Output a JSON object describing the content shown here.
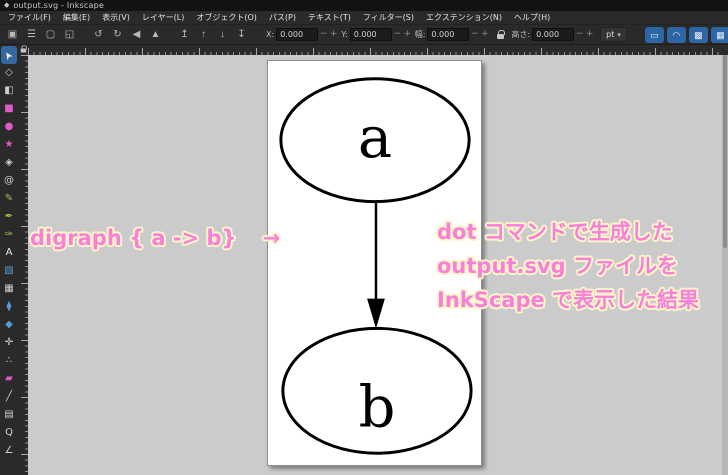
{
  "window": {
    "title": "output.svg - Inkscape",
    "icon_glyph": "◆"
  },
  "menubar": {
    "items": [
      "ファイル(F)",
      "編集(E)",
      "表示(V)",
      "レイヤー(L)",
      "オブジェクト(O)",
      "パス(P)",
      "テキスト(T)",
      "フィルター(S)",
      "エクステンション(N)",
      "ヘルプ(H)"
    ]
  },
  "toolbar": {
    "select_buttons": [
      {
        "name": "select-all-button",
        "glyph": "▣"
      },
      {
        "name": "select-all-layers-button",
        "glyph": "☰"
      },
      {
        "name": "deselect-button",
        "glyph": "▢"
      },
      {
        "name": "selection-box-button",
        "glyph": "◱"
      }
    ],
    "transform_buttons": [
      {
        "name": "rotate-ccw-button",
        "glyph": "↺"
      },
      {
        "name": "rotate-cw-button",
        "glyph": "↻"
      },
      {
        "name": "flip-horizontal-button",
        "glyph": "◀"
      },
      {
        "name": "flip-vertical-button",
        "glyph": "▲"
      }
    ],
    "order_buttons": [
      {
        "name": "raise-to-top-button",
        "glyph": "↥"
      },
      {
        "name": "raise-button",
        "glyph": "↑"
      },
      {
        "name": "lower-button",
        "glyph": "↓"
      },
      {
        "name": "lower-to-bottom-button",
        "glyph": "↧"
      }
    ],
    "fields": [
      {
        "name": "x-field",
        "label": "X:",
        "value": "0.000"
      },
      {
        "name": "y-field",
        "label": "Y:",
        "value": "0.000"
      },
      {
        "name": "width-field",
        "label": "幅:",
        "value": "0.000"
      },
      {
        "name": "height-field",
        "label": "高さ:",
        "value": "0.000"
      }
    ],
    "spinner": {
      "minus": "−",
      "plus": "+"
    },
    "unit": {
      "value": "pt",
      "caret": "▾"
    },
    "affect_toggles": [
      {
        "name": "scale-stroke-toggle",
        "glyph": "▭"
      },
      {
        "name": "scale-corners-toggle",
        "glyph": "◠"
      },
      {
        "name": "move-gradients-toggle",
        "glyph": "▩"
      },
      {
        "name": "move-patterns-toggle",
        "glyph": "▦"
      }
    ],
    "accent_color": "#2c66a4"
  },
  "toolbox": {
    "selected_color": "#36679e",
    "tools": [
      {
        "name": "tool-selector",
        "glyph": "➤",
        "color": "#f2f2f2",
        "selected": true
      },
      {
        "name": "tool-node-editor",
        "glyph": "◇",
        "color": "#cfcfcf",
        "selected": false
      },
      {
        "name": "tool-shape-builder",
        "glyph": "◧",
        "color": "#cfcfcf",
        "selected": false
      },
      {
        "name": "tool-rectangle",
        "glyph": "■",
        "color": "#df5bc8",
        "selected": false
      },
      {
        "name": "tool-ellipse",
        "glyph": "●",
        "color": "#df5bc8",
        "selected": false
      },
      {
        "name": "tool-star",
        "glyph": "★",
        "color": "#df5bc8",
        "selected": false
      },
      {
        "name": "tool-3d-box",
        "glyph": "◈",
        "color": "#cfcfcf",
        "selected": false
      },
      {
        "name": "tool-spiral",
        "glyph": "@",
        "color": "#cfcfcf",
        "selected": false
      },
      {
        "name": "tool-pencil",
        "glyph": "✎",
        "color": "#9bc24f",
        "selected": false
      },
      {
        "name": "tool-bezier-pen",
        "glyph": "✒",
        "color": "#9bc24f",
        "selected": false
      },
      {
        "name": "tool-calligraphy",
        "glyph": "✑",
        "color": "#9bc24f",
        "selected": false
      },
      {
        "name": "tool-text",
        "glyph": "A",
        "color": "#e8e8e8",
        "selected": false
      },
      {
        "name": "tool-gradient",
        "glyph": "▧",
        "color": "#5b9bd5",
        "selected": false
      },
      {
        "name": "tool-mesh-gradient",
        "glyph": "▦",
        "color": "#cfcfcf",
        "selected": false
      },
      {
        "name": "tool-dropper",
        "glyph": "⧫",
        "color": "#5b9bd5",
        "selected": false
      },
      {
        "name": "tool-paint-bucket",
        "glyph": "◆",
        "color": "#5b9bd5",
        "selected": false
      },
      {
        "name": "tool-tweak",
        "glyph": "✛",
        "color": "#cfcfcf",
        "selected": false
      },
      {
        "name": "tool-spray",
        "glyph": "∴",
        "color": "#cfcfcf",
        "selected": false
      },
      {
        "name": "tool-eraser",
        "glyph": "▰",
        "color": "#df5bc8",
        "selected": false
      },
      {
        "name": "tool-connector",
        "glyph": "╱",
        "color": "#cfcfcf",
        "selected": false
      },
      {
        "name": "tool-pages",
        "glyph": "▤",
        "color": "#cfcfcf",
        "selected": false
      },
      {
        "name": "tool-zoom",
        "glyph": "Q",
        "color": "#cfcfcf",
        "selected": false
      },
      {
        "name": "tool-measure",
        "glyph": "∠",
        "color": "#cfcfcf",
        "selected": false
      }
    ]
  },
  "canvas": {
    "background_color": "#cbcbcb",
    "page_color": "#ffffff",
    "drawing": {
      "node_a_label": "a",
      "node_b_label": "b",
      "stroke_color": "#000000"
    },
    "annotations": {
      "text_color": "#f97fd9",
      "outline_color": "#fcf5c9",
      "left_code": "digraph { a -> b}",
      "arrow_symbol": "→",
      "right_lines": [
        "dot コマンドで生成した",
        "output.svg ファイルを",
        "InkScape で表示した結果"
      ]
    }
  }
}
